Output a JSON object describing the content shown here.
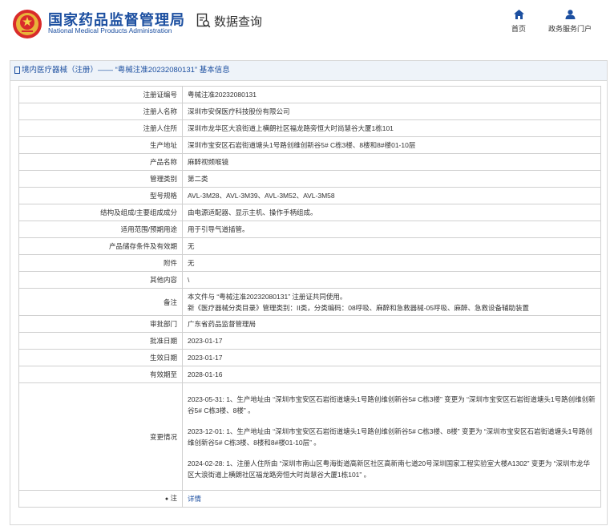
{
  "header": {
    "brand_cn": "国家药品监督管理局",
    "brand_en": "National Medical Products Administration",
    "search_label": "数据查询",
    "nav": {
      "home": "首页",
      "services": "政务服务门户"
    },
    "accent_color": "#1c4fa0"
  },
  "panel": {
    "title": "境内医疗器械（注册）—— “粤械注准20232080131” 基本信息"
  },
  "rows": {
    "reg_no": {
      "label": "注册证编号",
      "value": "粤械注准20232080131"
    },
    "registrant": {
      "label": "注册人名称",
      "value": "深圳市安保医疗科技股份有限公司"
    },
    "address": {
      "label": "注册人住所",
      "value": "深圳市龙华区大浪街道上横朗社区福龙路旁恒大时尚慧谷大厦1栋101"
    },
    "production": {
      "label": "生产地址",
      "value": "深圳市宝安区石岩街道塘头1号路创维创新谷5# C栋3楼、8楼和8#楼01-10层"
    },
    "product": {
      "label": "产品名称",
      "value": "麻醉视频喉镜"
    },
    "category": {
      "label": "管理类别",
      "value": "第二类"
    },
    "model": {
      "label": "型号规格",
      "value": "AVL-3M28、AVL-3M39、AVL-3M52、AVL-3M58"
    },
    "structure": {
      "label": "结构及组成/主要组成成分",
      "value": "由电源适配器、显示主机、操作手柄组成。"
    },
    "scope": {
      "label": "适用范围/预期用途",
      "value": "用于引导气道插管。"
    },
    "storage": {
      "label": "产品储存条件及有效期",
      "value": "无"
    },
    "attachment": {
      "label": "附件",
      "value": "无"
    },
    "other": {
      "label": "其他内容",
      "value": "\\"
    },
    "remark": {
      "label": "备注",
      "line1": "本文件与 “粤械注准20232080131” 注册证共同使用。",
      "line2": "新《医疗器械分类目录》管理类别：II类，分类编码：08呼吸、麻醉和急救器械-05呼吸、麻醉、急救设备辅助装置"
    },
    "dept": {
      "label": "审批部门",
      "value": "广东省药品监督管理局"
    },
    "approve_date": {
      "label": "批准日期",
      "value": "2023-01-17"
    },
    "effect_date": {
      "label": "生效日期",
      "value": "2023-01-17"
    },
    "expire_date": {
      "label": "有效期至",
      "value": "2028-01-16"
    },
    "changes": {
      "label": "变更情况",
      "c1": "2023-05-31: 1、生产地址由 “深圳市宝安区石岩街道塘头1号路创维创新谷5# C栋3楼” 变更为 “深圳市宝安区石岩街道塘头1号路创维创新谷5# C栋3楼、8楼” 。",
      "c2": "2023-12-01: 1、生产地址由 “深圳市宝安区石岩街道塘头1号路创维创新谷5# C栋3楼、8楼” 变更为 “深圳市宝安区石岩街道塘头1号路创维创新谷5# C栋3楼、8楼和8#楼01-10层” 。",
      "c3": "2024-02-28: 1、注册人住所由 “深圳市南山区粤海街道高新区社区高新南七道20号深圳国家工程实验室大楼A1302” 变更为 “深圳市龙华区大浪街道上横朗社区福龙路旁恒大时尚慧谷大厦1栋101” 。"
    },
    "note": {
      "label": "注",
      "value": "详情"
    }
  }
}
